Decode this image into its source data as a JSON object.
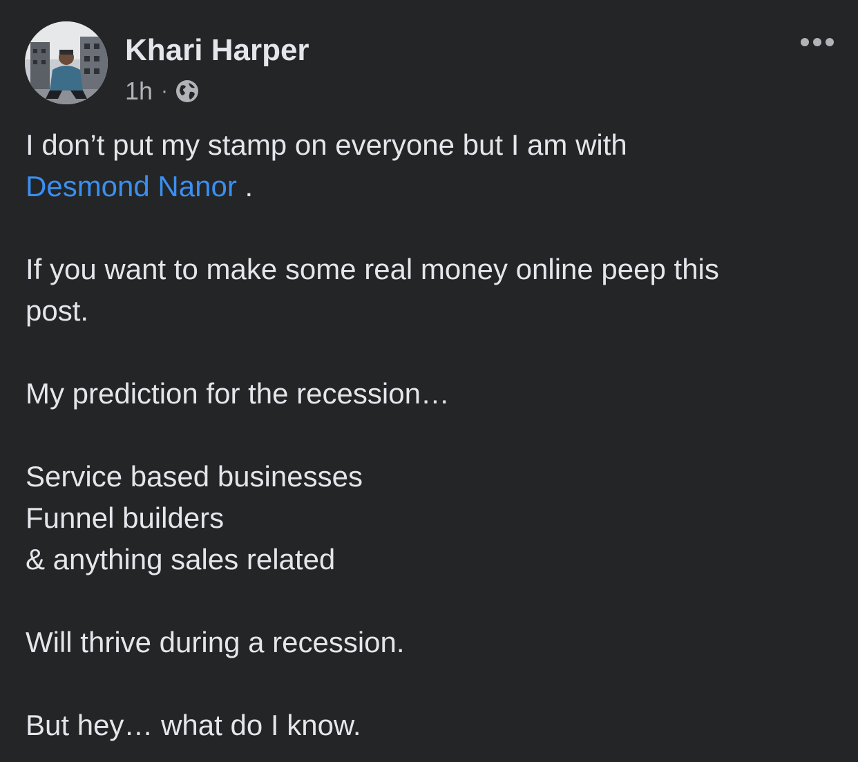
{
  "post": {
    "author": {
      "name": "Khari Harper",
      "avatar_icon": "profile-photo"
    },
    "timestamp": "1h",
    "separator": "·",
    "privacy_icon": "globe-icon",
    "more_icon": "more-options-icon",
    "body": {
      "line1_text": "I don’t put my stamp on everyone but I am with",
      "mention": "Desmond Nanor",
      "mention_suffix": " .",
      "paragraph2_line1": "If you want to make some real money online peep this",
      "paragraph2_line2": "post.",
      "paragraph3": "My prediction for the recession…",
      "list": [
        "Service based businesses",
        "Funnel builders",
        "& anything sales related"
      ],
      "paragraph5": "Will thrive during a recession.",
      "paragraph6": "But hey… what do I know."
    }
  },
  "colors": {
    "background": "#242526",
    "primary_text": "#e4e6eb",
    "secondary_text": "#b0b3b8",
    "mention_link": "#3a8ff0"
  }
}
